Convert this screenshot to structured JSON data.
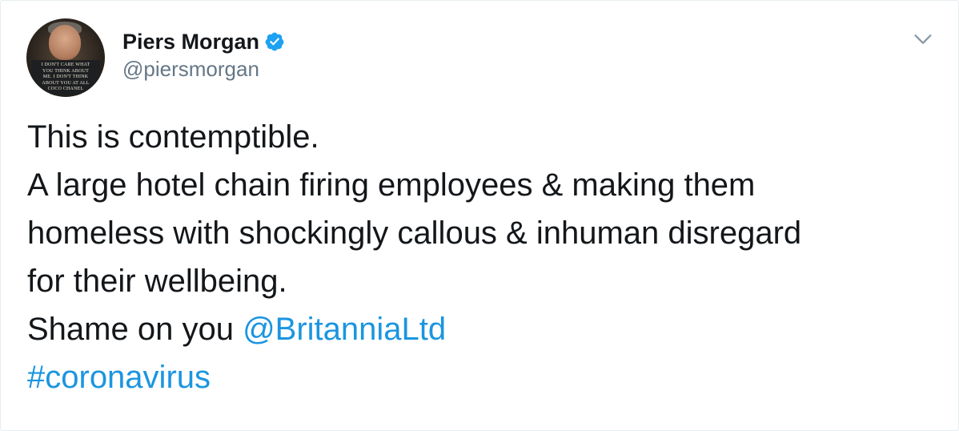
{
  "author": {
    "display_name": "Piers Morgan",
    "handle": "@piersmorgan",
    "verified": true,
    "avatar_sign_text": [
      "I DON'T CARE WHAT",
      "YOU THINK ABOUT",
      "ME. I DON'T THINK",
      "ABOUT YOU AT ALL",
      "COCO CHANEL"
    ]
  },
  "menu": {
    "icon": "chevron-down-icon"
  },
  "tweet": {
    "line1": "This is contemptible.",
    "line2": "A large hotel chain firing employees & making them",
    "line3": "homeless with shockingly callous & inhuman disregard",
    "line4": "for their wellbeing.",
    "line5_text": "Shame on you ",
    "mention": "@BritanniaLtd",
    "hashtag": "#coronavirus"
  },
  "colors": {
    "text": "#14171a",
    "secondary": "#657786",
    "link": "#1b95e0",
    "verified_badge": "#1da1f2",
    "border": "#e6ecf0"
  }
}
